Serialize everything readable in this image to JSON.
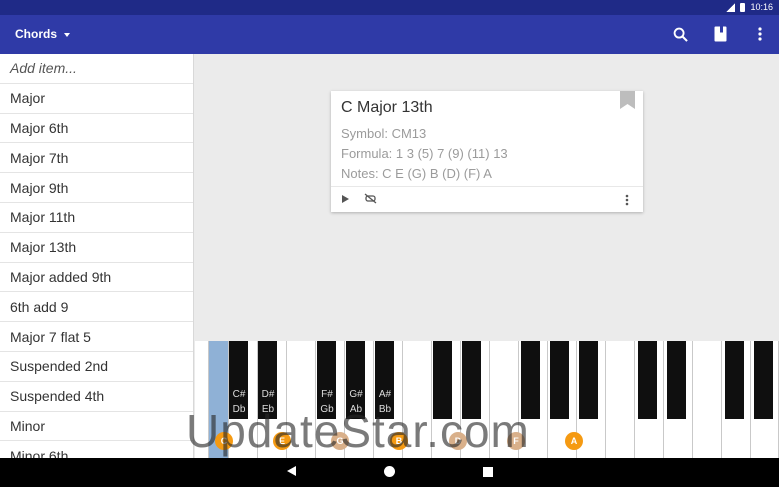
{
  "status_bar": {
    "time": "10:16"
  },
  "app_bar": {
    "title": "Chords",
    "icons": [
      "dropdown-caret",
      "search-icon",
      "book-icon",
      "overflow-menu-icon"
    ]
  },
  "sidebar": {
    "items": [
      "Add item...",
      "Major",
      "Major 6th",
      "Major 7th",
      "Major 9th",
      "Major 11th",
      "Major 13th",
      "Major added 9th",
      "6th add 9",
      "Major 7 flat 5",
      "Suspended 2nd",
      "Suspended 4th",
      "Minor",
      "Minor 6th"
    ]
  },
  "card": {
    "title": "C Major 13th",
    "symbol": "Symbol: CM13",
    "formula": "Formula: 1 3 (5) 7 (9) (11) 13",
    "notes": "Notes: C E (G) B (D) (F) A",
    "icons": [
      "bookmark-icon",
      "play-icon",
      "sound-off-icon",
      "overflow-menu-icon"
    ]
  },
  "keyboard": {
    "black_key_labels": [
      {
        "sharp": "C#",
        "flat": "Db"
      },
      {
        "sharp": "D#",
        "flat": "Eb"
      },
      {
        "sharp": "F#",
        "flat": "Gb"
      },
      {
        "sharp": "G#",
        "flat": "Ab"
      },
      {
        "sharp": "A#",
        "flat": "Bb"
      }
    ],
    "note_dots": [
      "C",
      "E",
      "G",
      "A",
      "B",
      "D",
      "F",
      "A"
    ]
  },
  "watermark": "UpdateStar.com",
  "nav_bar": {
    "icons": [
      "back-icon",
      "home-icon",
      "recents-icon"
    ]
  }
}
